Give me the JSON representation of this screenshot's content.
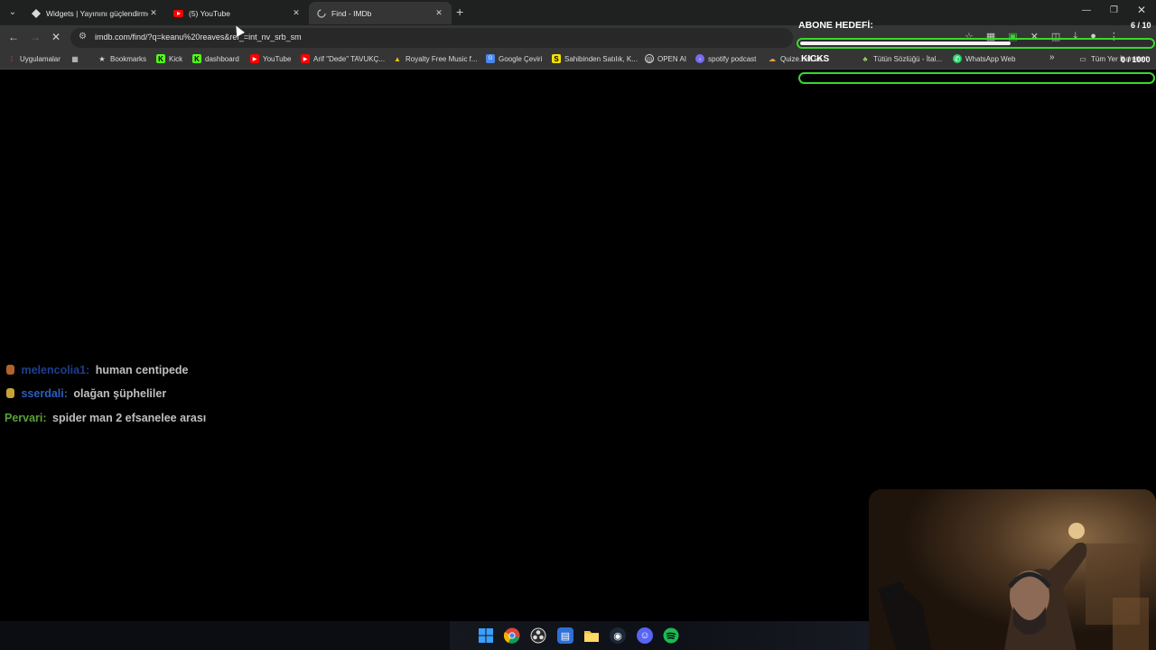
{
  "browser": {
    "tabs": [
      {
        "title": "Widgets | Yayınını güçlendirme",
        "icon": "widget-favicon-icon",
        "active": false
      },
      {
        "title": "(5) YouTube",
        "icon": "youtube-favicon-icon",
        "active": false
      },
      {
        "title": "Find - IMDb",
        "icon": "loading-spinner-icon",
        "active": true
      }
    ],
    "url": "imdb.com/find/?q=keanu%20reaves&ref_=int_nv_srb_sm",
    "bookmarks": [
      {
        "label": "Uygulamalar",
        "icon": "apps-grid-icon"
      },
      {
        "label": "",
        "icon": "grid-icon"
      },
      {
        "label": "Bookmarks",
        "icon": "star-icon"
      },
      {
        "label": "Kick",
        "icon": "kick-icon"
      },
      {
        "label": "dashboard",
        "icon": "kick-icon"
      },
      {
        "label": "YouTube",
        "icon": "youtube-icon"
      },
      {
        "label": "Arif \"Dede\" TAVUKÇ...",
        "icon": "youtube-icon"
      },
      {
        "label": "Royalty Free Music f...",
        "icon": "triangle-icon"
      },
      {
        "label": "Google Çeviri",
        "icon": "translate-icon"
      },
      {
        "label": "Sahibinden Satılık, K...",
        "icon": "sahibinden-icon"
      },
      {
        "label": "OPEN AI",
        "icon": "openai-icon"
      },
      {
        "label": "spotify podcast",
        "icon": "podcast-icon"
      },
      {
        "label": "Quize...eli ve...",
        "icon": "quiz-icon"
      },
      {
        "label": "Tütün Sözlüğü - İtal...",
        "icon": "leaf-icon"
      },
      {
        "label": "WhatsApp Web",
        "icon": "whatsapp-icon"
      }
    ],
    "bookmarks_more": "»",
    "all_bookmarks": "Tüm Yer İşaretleri"
  },
  "overlay": {
    "goal_label": "ABONE HEDEFİ:",
    "goal_count": "6 / 10",
    "goal_progress": 0.6,
    "kicks_label": "KICKS",
    "kicks_count": "0 / 1000",
    "kicks_progress": 0
  },
  "chat": [
    {
      "user": "melencolia1:",
      "message": "human centipede",
      "user_color": "#1d3f8f",
      "badge_color": "#b0632a"
    },
    {
      "user": "sserdali:",
      "message": "olağan şüpheliler",
      "user_color": "#2a5fc2",
      "badge_color": "#c9a235"
    },
    {
      "user": "Pervari:",
      "message": "spider man 2 efsanelee arası",
      "user_color": "#5aa23a",
      "badge_color": ""
    }
  ],
  "taskbar": {
    "icons": [
      "windows-start-icon",
      "chrome-icon",
      "obs-icon",
      "store-icon",
      "file-explorer-icon",
      "steam-icon",
      "discord-icon",
      "spotify-icon"
    ]
  },
  "colors": {
    "accent_green": "#38d82c",
    "browser_dark": "#353535"
  }
}
